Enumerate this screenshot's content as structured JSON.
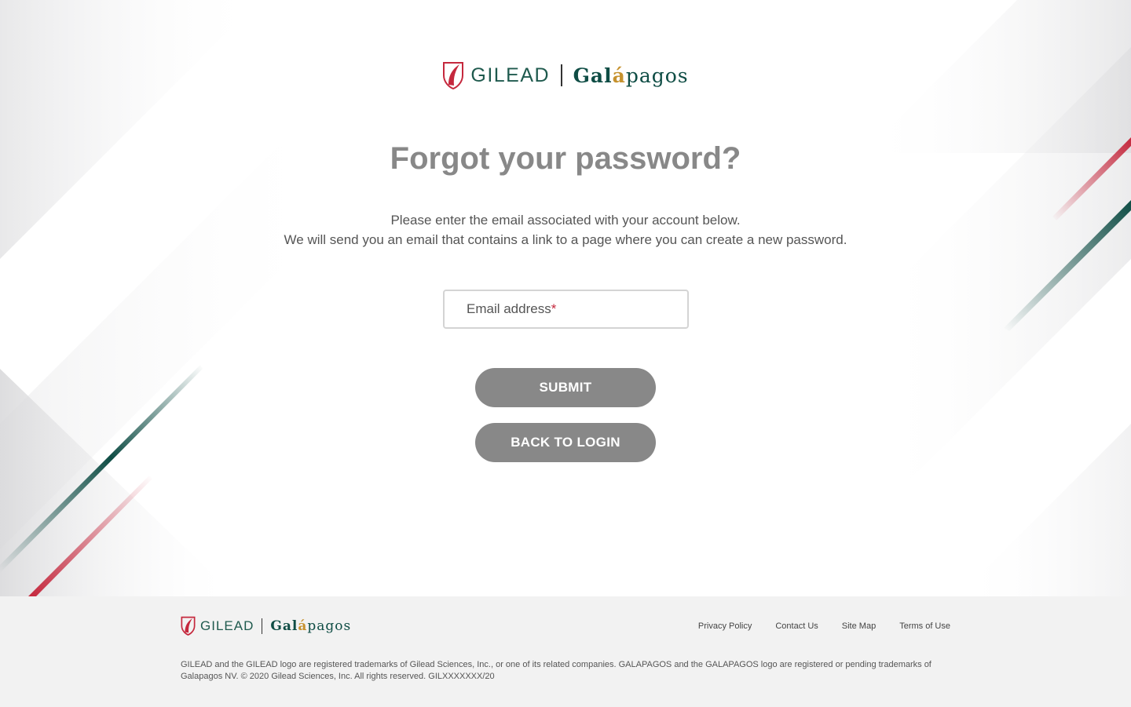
{
  "logo": {
    "gilead_text": "GILEAD",
    "galapagos_parts": {
      "a": "Gal",
      "b": "á",
      "c": "pagos"
    }
  },
  "page": {
    "title": "Forgot your password?",
    "description_line1": "Please enter the email associated with your account below.",
    "description_line2": "We will send you an email that contains a link to a page where you can create a new password."
  },
  "form": {
    "email_label": "Email address",
    "required_marker": "*",
    "submit_label": "SUBMIT",
    "back_label": "BACK TO LOGIN"
  },
  "footer": {
    "links": [
      "Privacy Policy",
      "Contact Us",
      "Site Map",
      "Terms of Use"
    ],
    "legal_text": "GILEAD and the GILEAD logo are registered trademarks of Gilead Sciences, Inc., or one of its related companies. GALAPAGOS and the GALAPAGOS logo are registered or pending trademarks of Galapagos NV. © 2020 Gilead Sciences, Inc. All rights reserved. GILXXXXXXX/20"
  },
  "colors": {
    "button_bg": "#888888",
    "brand_green": "#0f4d45",
    "brand_red": "#c5283d",
    "footer_bg": "#f2f2f2"
  }
}
